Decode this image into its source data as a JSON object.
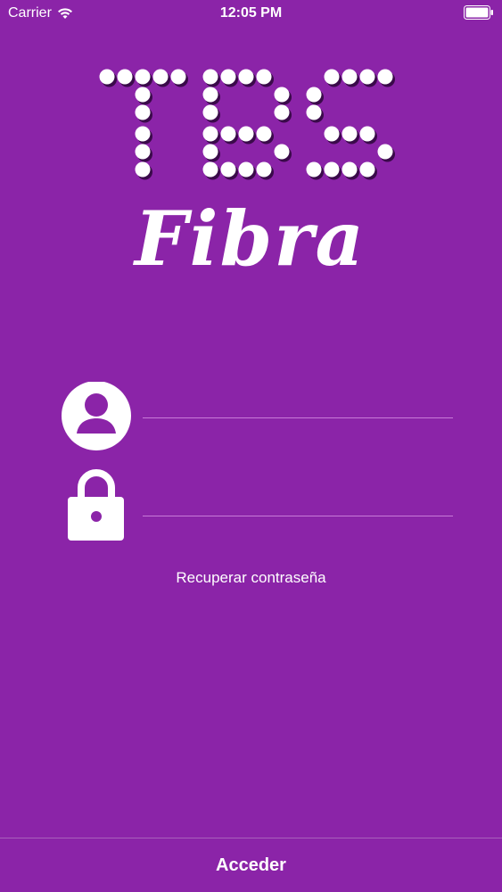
{
  "status_bar": {
    "carrier": "Carrier",
    "time": "12:05 PM",
    "wifi_icon": "wifi-icon",
    "battery_icon": "battery-icon"
  },
  "logo": {
    "brand": "TBS",
    "product": "Fibra"
  },
  "form": {
    "username": {
      "icon": "user-icon",
      "value": "",
      "placeholder": ""
    },
    "password": {
      "icon": "lock-icon",
      "value": "",
      "placeholder": ""
    },
    "recover_label": "Recuperar contraseña",
    "submit_label": "Acceder"
  },
  "colors": {
    "background": "#8b24a8",
    "text": "#ffffff",
    "underline": "#c87ad8"
  }
}
